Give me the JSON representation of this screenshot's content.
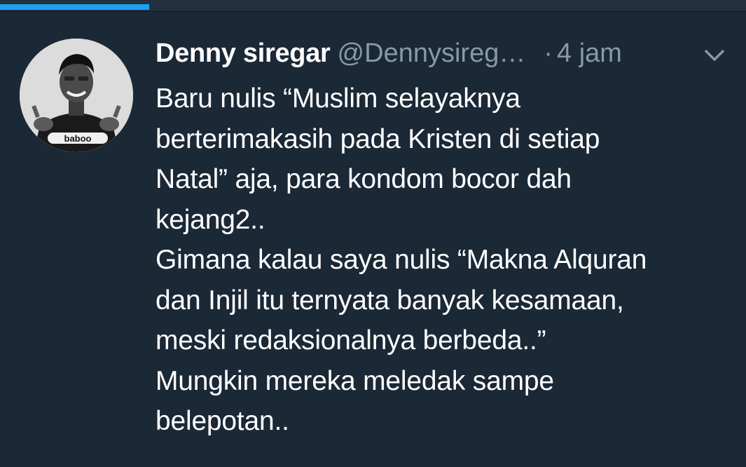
{
  "top_bar": {
    "progress_fraction": 0.2
  },
  "tweet": {
    "author_name": "Denny siregar",
    "handle": "@Dennysireg…",
    "separator": "·",
    "timestamp": "4 jam",
    "avatar_shirt_text": "baboo",
    "lines": [
      "Baru nulis “Muslim selayaknya",
      "berterimakasih pada Kristen di setiap",
      "Natal” aja, para kondom bocor dah",
      "kejang2..",
      "Gimana kalau saya nulis “Makna Alquran",
      "dan Injil itu ternyata banyak kesamaan,",
      "meski redaksionalnya berbeda..”",
      "Mungkin mereka meledak sampe",
      "belepotan.."
    ]
  },
  "colors": {
    "background": "#1b2836",
    "accent": "#1da1f2",
    "secondary_text": "#8899a6",
    "primary_text": "#ffffff"
  },
  "icons": {
    "menu": "chevron-down-icon",
    "avatar": "profile-photo"
  }
}
